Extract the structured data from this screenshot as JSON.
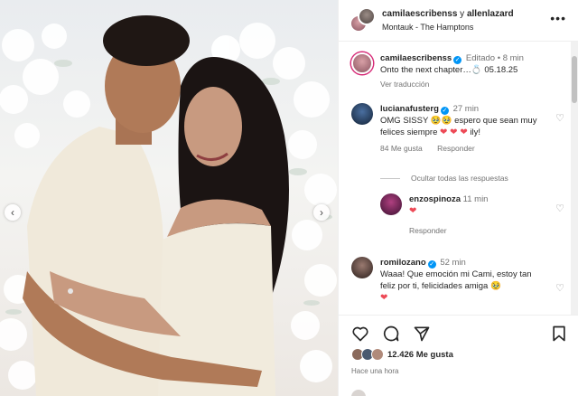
{
  "post": {
    "header": {
      "author": "camilaescribenss",
      "connector": " y ",
      "coauthor": "allenlazard",
      "location": "Montauk - The Hamptons"
    },
    "caption": {
      "username": "camilaescribenss",
      "edited": "Editado",
      "time": "8 min",
      "text": "Onto the next chapter…💍 05.18.25",
      "translation": "Ver traducción"
    },
    "comments": [
      {
        "username": "lucianafusterg",
        "time": "27 min",
        "text_main": "OMG SISSY 🥹🥹 espero que sean muy felices siempre",
        "hearts": "❤ ❤ ❤",
        "text_tail": " ily!",
        "likes": "84 Me gusta",
        "reply": "Responder"
      },
      {
        "username": "enzospinoza",
        "time": "11 min",
        "hearts": "❤",
        "reply": "Responder"
      },
      {
        "username": "romilozano",
        "time": "52 min",
        "text_main": "Waaa! Que emoción mi Cami, estoy tan feliz por ti, felicidades amiga 🥹",
        "hearts": "❤"
      }
    ],
    "hide_replies": "Ocultar todas las respuestas",
    "likes_count": "12.426 Me gusta",
    "time_ago": "Hace una hora"
  },
  "icons": {
    "more": "more-icon",
    "verified": "verified-badge-icon",
    "like": "heart-outline-icon",
    "comment": "comment-icon",
    "share": "share-icon",
    "save": "bookmark-icon",
    "prev": "chevron-left-icon",
    "next": "chevron-right-icon"
  },
  "colors": {
    "verified": "#0095f6",
    "heart": "#ed4956",
    "meta_text": "#737373",
    "primary_text": "#262626"
  }
}
